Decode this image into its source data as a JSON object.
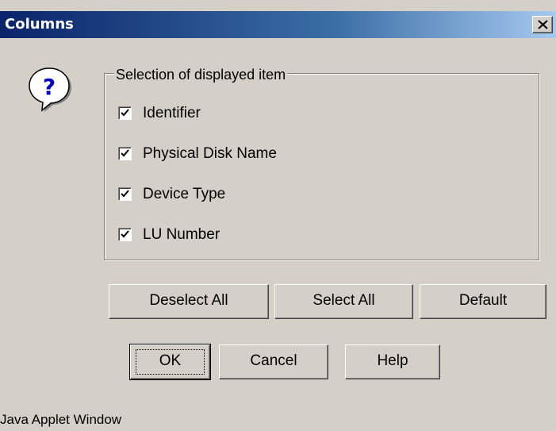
{
  "window": {
    "title": "Columns",
    "close_label": "×"
  },
  "icon": {
    "name": "question-icon",
    "glyph": "?"
  },
  "group": {
    "legend": "Selection of displayed item",
    "items": [
      {
        "label": "Identifier",
        "checked": true
      },
      {
        "label": "Physical Disk Name",
        "checked": true
      },
      {
        "label": "Device Type",
        "checked": true
      },
      {
        "label": "LU Number",
        "checked": true
      }
    ]
  },
  "selection_buttons": {
    "deselect_all": "Deselect All",
    "select_all": "Select All",
    "default": "Default"
  },
  "dialog_buttons": {
    "ok": "OK",
    "cancel": "Cancel",
    "help": "Help"
  },
  "status": {
    "text": "Java Applet Window"
  },
  "colors": {
    "face": "#d4d0c8",
    "title_start": "#0a246a",
    "title_end": "#a6caf0",
    "icon_blue": "#0000c0"
  }
}
